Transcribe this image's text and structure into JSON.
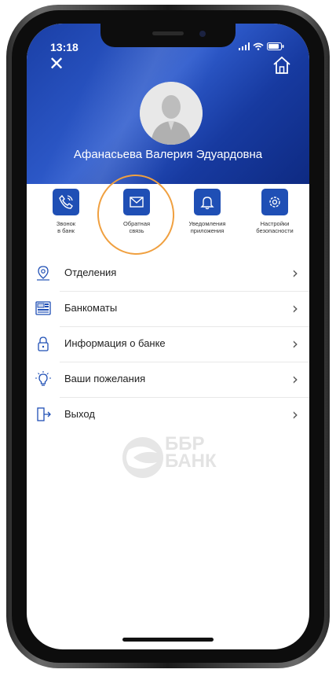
{
  "status_bar": {
    "time": "13:18"
  },
  "profile": {
    "name": "Афанасьева Валерия Эдуардовна"
  },
  "header": {
    "close_symbol": "✕"
  },
  "quick_actions": [
    {
      "line1": "Звонок",
      "line2": "в банк",
      "icon": "phone-icon"
    },
    {
      "line1": "Обратная",
      "line2": "связь",
      "icon": "mail-icon"
    },
    {
      "line1": "Уведомления",
      "line2": "приложения",
      "icon": "bell-icon"
    },
    {
      "line1": "Настройки",
      "line2": "безопасности",
      "icon": "gear-icon"
    }
  ],
  "menu": [
    {
      "label": "Отделения",
      "icon": "map-pin-icon"
    },
    {
      "label": "Банкоматы",
      "icon": "atm-icon"
    },
    {
      "label": "Информация о банке",
      "icon": "lock-icon"
    },
    {
      "label": "Ваши пожелания",
      "icon": "lightbulb-icon"
    },
    {
      "label": "Выход",
      "icon": "logout-icon"
    }
  ],
  "chevron": "›",
  "logo": {
    "line1": "ББР",
    "line2": "БАНК"
  },
  "colors": {
    "accent": "#1f4fb5",
    "highlight": "#f0a040"
  }
}
